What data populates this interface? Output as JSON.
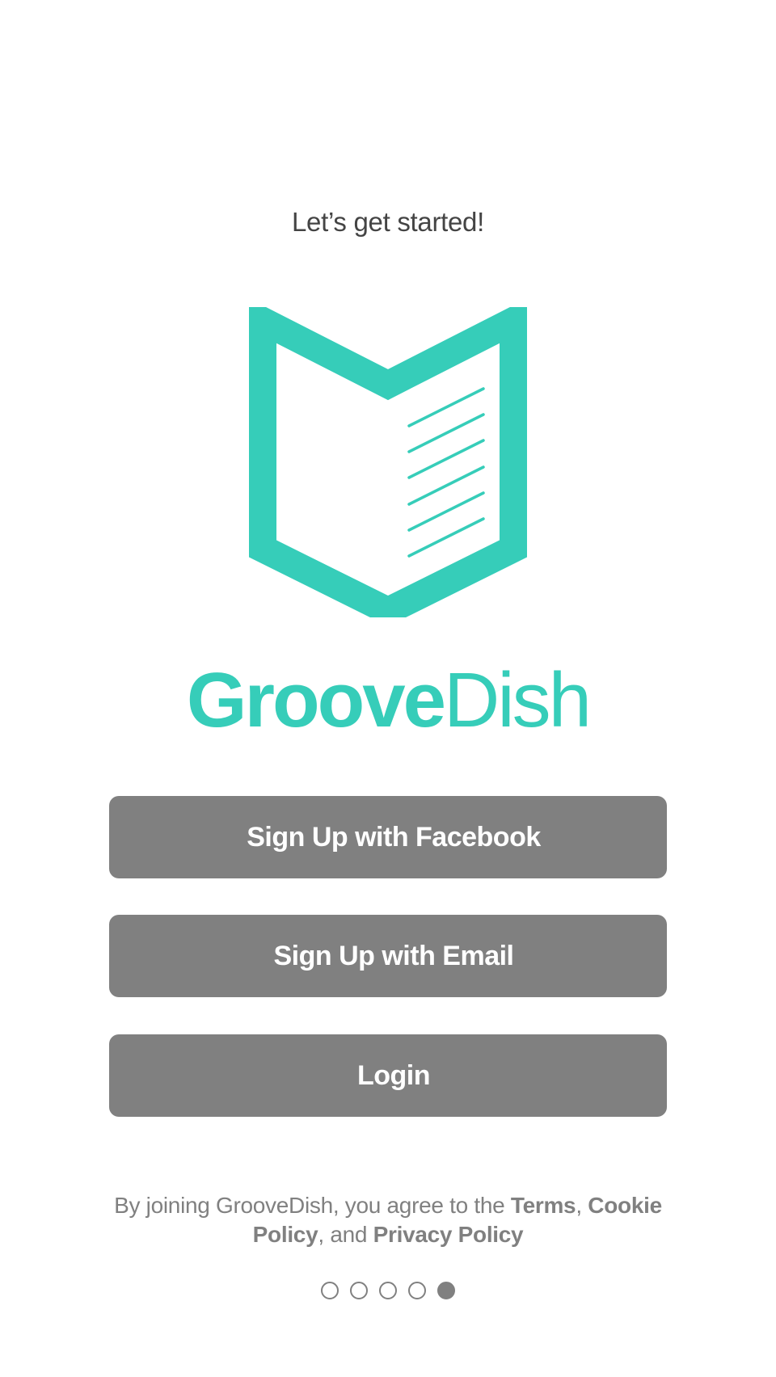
{
  "heading": "Let’s get started!",
  "brand": {
    "name_bold": "Groove",
    "name_light": "Dish",
    "color": "#36CDB9",
    "logo_icon": "open-book-icon"
  },
  "buttons": {
    "facebook": "Sign Up with Facebook",
    "email": "Sign Up with Email",
    "login": "Login",
    "color": "#808080"
  },
  "legal": {
    "prefix": "By joining GrooveDish, you agree to the ",
    "terms": "Terms",
    "sep1": ", ",
    "cookie": "Cookie Policy",
    "sep2": ", and ",
    "privacy": "Privacy Policy"
  },
  "pager": {
    "total": 5,
    "active_index": 4
  }
}
